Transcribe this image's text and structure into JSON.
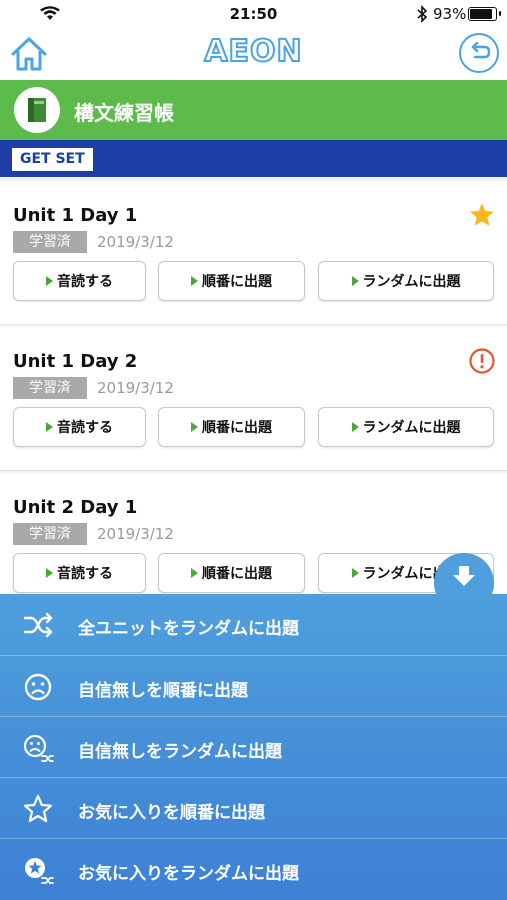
{
  "status_bar": {
    "time": "21:50",
    "battery": "93%",
    "battery_level": 0.93
  },
  "header": {
    "logo": "AEON"
  },
  "title_band": {
    "title": "構文練習帳"
  },
  "set_label": "GET SET",
  "units": [
    {
      "title": "Unit 1 Day 1",
      "status": "学習済",
      "date": "2019/3/12",
      "mark": "star-icon",
      "buttons": [
        "音読する",
        "順番に出題",
        "ランダムに出題"
      ]
    },
    {
      "title": "Unit 1 Day 2",
      "status": "学習済",
      "date": "2019/3/12",
      "mark": "alert-icon",
      "buttons": [
        "音読する",
        "順番に出題",
        "ランダムに出題"
      ]
    },
    {
      "title": "Unit 2 Day 1",
      "status": "学習済",
      "date": "2019/3/12",
      "mark": "",
      "buttons": [
        "音読する",
        "順番に出題",
        "ランダムに出題"
      ]
    }
  ],
  "menu": [
    {
      "label": "全ユニットをランダムに出題",
      "icon": "shuffle-icon"
    },
    {
      "label": "自信無しを順番に出題",
      "icon": "sad-face-icon"
    },
    {
      "label": "自信無しをランダムに出題",
      "icon": "sad-face-shuffle-icon"
    },
    {
      "label": "お気に入りを順番に出題",
      "icon": "star-outline-icon"
    },
    {
      "label": "お気に入りをランダムに出題",
      "icon": "star-shuffle-icon"
    }
  ],
  "colors": {
    "accent_blue": "#4aa3e4",
    "title_green": "#5cbb4a",
    "set_band_blue": "#1d3ea7",
    "drawer_blue": "#3d80d4",
    "star": "#f6b81c",
    "alert": "#e8542b"
  }
}
